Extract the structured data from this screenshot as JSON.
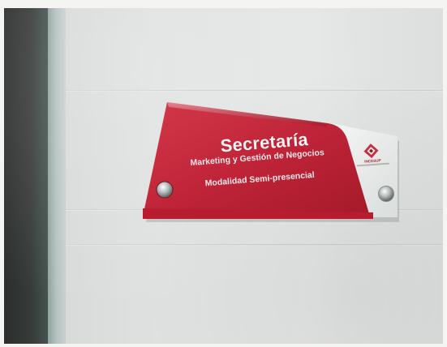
{
  "sign": {
    "title": "Secretaría",
    "subtitle": "Marketing y Gestión de Negocios",
    "modality": "Modalidad Semi-presencial",
    "logo_text": "INCESUP",
    "colors": {
      "plaque_red": "#c4283a",
      "plaque_dark_red": "#9a1624",
      "plaque_light": "#eef0f0",
      "wall": "#e0e3e2",
      "dark_strip": "#30343a"
    },
    "icons": [
      "left-screw-icon",
      "right-screw-icon",
      "institution-logo-icon"
    ]
  }
}
